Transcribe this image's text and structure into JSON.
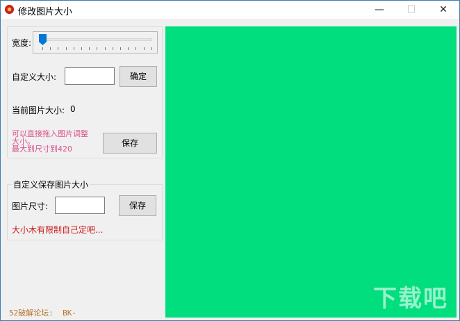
{
  "window": {
    "title": "修改图片大小",
    "minimize": "—",
    "maximize": "☐",
    "close": "✕"
  },
  "resize": {
    "width_label": "宽度:",
    "slider_value": 0,
    "custom_label": "自定义大小:",
    "custom_value": "",
    "confirm": "确定",
    "current_label": "当前图片大小:",
    "current_value": "0",
    "hint": "可以直接拖入图片调整大小。\n最大到尺寸到420",
    "save": "保存"
  },
  "save_group": {
    "title": "自定义保存图片大小",
    "size_label": "图片尺寸:",
    "size_value": "",
    "save": "保存",
    "note": "大小木有限制自己定吧..."
  },
  "footer": "52破解论坛:  BK-",
  "canvas_color": "#00de7e",
  "watermark": "下载吧"
}
